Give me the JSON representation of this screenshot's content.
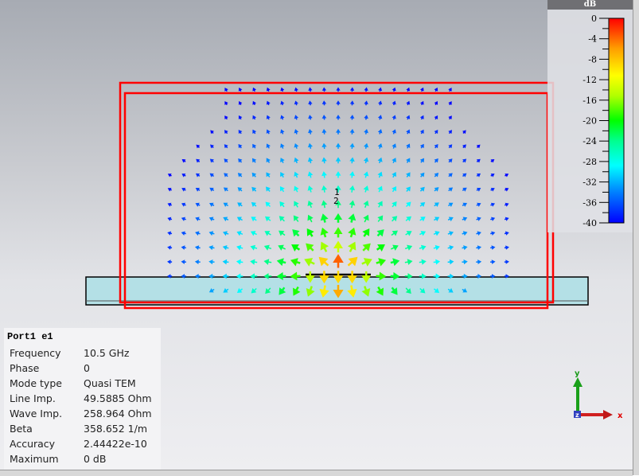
{
  "legend": {
    "unit": "dB",
    "ticks": [
      "0",
      "-4",
      "-8",
      "-12",
      "-16",
      "-20",
      "-24",
      "-28",
      "-32",
      "-36",
      "-40"
    ],
    "range": [
      -40,
      0
    ],
    "colormap": [
      "#0000ff",
      "#0080ff",
      "#00ffff",
      "#00ff80",
      "#00ff00",
      "#80ff00",
      "#ffff00",
      "#ffa000",
      "#ff0000"
    ]
  },
  "port_labels": [
    "1",
    "2"
  ],
  "info": {
    "title": "Port1 e1",
    "rows": [
      {
        "k": "Frequency",
        "v": "10.5 GHz"
      },
      {
        "k": "Phase",
        "v": "0"
      },
      {
        "k": "Mode type",
        "v": "Quasi TEM"
      },
      {
        "k": "Line Imp.",
        "v": "49.5885 Ohm"
      },
      {
        "k": "Wave Imp.",
        "v": "258.964 Ohm"
      },
      {
        "k": "Beta",
        "v": "358.652 1/m"
      },
      {
        "k": "Accuracy",
        "v": "2.44422e-10"
      },
      {
        "k": "Maximum",
        "v": "0 dB"
      }
    ]
  },
  "axes": {
    "x": "x",
    "y": "y",
    "z": "z"
  },
  "colors": {
    "port_box": "#ff0000",
    "substrate": "#b4e0e6"
  }
}
